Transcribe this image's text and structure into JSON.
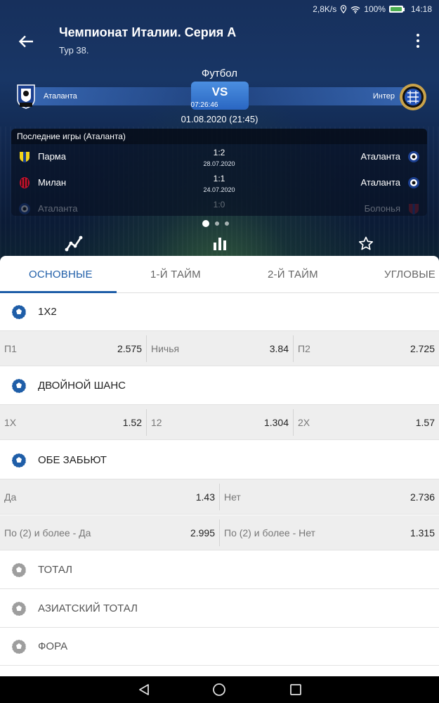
{
  "status_bar": {
    "speed": "2,8K/s",
    "battery_text": "100%",
    "battery_level": 1.0,
    "time": "14:18",
    "icons": [
      "location-icon",
      "wifi-icon",
      "battery-icon"
    ]
  },
  "header": {
    "title": "Чемпионат Италии. Серия А",
    "round": "Тур 38.",
    "back_icon": "arrow-left-icon",
    "menu_icon": "more-vert-icon"
  },
  "match": {
    "sport": "Футбол",
    "home_team": "Аталанта",
    "away_team": "Интер",
    "vs_label": "VS",
    "countdown": "07:26:46",
    "date": "01.08.2020 (21:45)"
  },
  "last_games": {
    "header": "Последние игры (Аталанта)",
    "rows": [
      {
        "home": "Парма",
        "score": "1:2",
        "date": "28.07.2020",
        "away": "Аталанта"
      },
      {
        "home": "Милан",
        "score": "1:1",
        "date": "24.07.2020",
        "away": "Аталанта"
      },
      {
        "home": "Аталанта",
        "score": "1:0",
        "date": "",
        "away": "Болонья"
      }
    ],
    "pages": 3,
    "active_page": 1
  },
  "hero_actions": {
    "icons": [
      "trend-chart-icon",
      "bar-chart-icon",
      "star-outline-icon"
    ]
  },
  "tabs": [
    {
      "label": "Основные",
      "active": true
    },
    {
      "label": "1-й тайм",
      "active": false
    },
    {
      "label": "2-й тайм",
      "active": false
    },
    {
      "label": "Угловые",
      "active": false
    }
  ],
  "markets": {
    "m1x2": {
      "name": "1X2",
      "odds": [
        {
          "label": "П1",
          "value": "2.575"
        },
        {
          "label": "Ничья",
          "value": "3.84"
        },
        {
          "label": "П2",
          "value": "2.725"
        }
      ]
    },
    "double_chance": {
      "name": "ДВОЙНОЙ ШАНС",
      "odds": [
        {
          "label": "1X",
          "value": "1.52"
        },
        {
          "label": "12",
          "value": "1.304"
        },
        {
          "label": "2X",
          "value": "1.57"
        }
      ]
    },
    "both_score": {
      "name": "ОБЕ ЗАБЬЮТ",
      "odds": [
        {
          "label": "Да",
          "value": "1.43"
        },
        {
          "label": "Нет",
          "value": "2.736"
        },
        {
          "label": "По (2) и более - Да",
          "value": "2.995"
        },
        {
          "label": "По (2) и более - Нет",
          "value": "1.315"
        }
      ]
    },
    "collapsed": [
      {
        "name": "ТОТАЛ"
      },
      {
        "name": "АЗИАТСКИЙ ТОТАЛ"
      },
      {
        "name": "ФОРА"
      }
    ]
  },
  "colors": {
    "accent": "#1f5ea8",
    "header_bg": "#17305c",
    "odds_bg": "#eeeeee"
  },
  "nav": {
    "icons": [
      "back-triangle-icon",
      "home-circle-icon",
      "recents-square-icon"
    ]
  }
}
